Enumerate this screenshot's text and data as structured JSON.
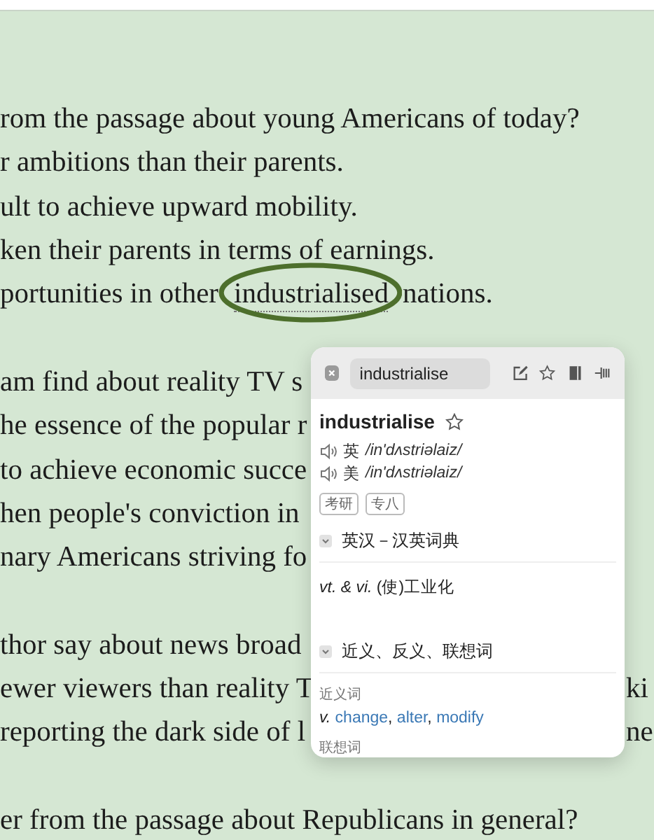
{
  "paragraphs": [
    {
      "lines": [
        {
          "text": "rom the passage about young Americans of today?"
        },
        {
          "text": "r ambitions than their parents."
        },
        {
          "text": "ult to achieve upward mobility."
        },
        {
          "text": "ken their parents in terms of earnings."
        },
        {
          "text": "portunities in other",
          "highlight": "industrialised",
          "after": "nations."
        }
      ]
    },
    {
      "lines": [
        {
          "text": "am find about reality TV s"
        },
        {
          "text": "he essence of the popular r"
        },
        {
          "text": " to achieve economic succe"
        },
        {
          "text": "hen people's conviction in"
        },
        {
          "text": "nary Americans striving fo"
        }
      ]
    },
    {
      "lines": [
        {
          "text": "thor say about news broad"
        },
        {
          "text": "ewer viewers than reality T",
          "right": "ki"
        },
        {
          "text": "reporting the dark side of l",
          "right": "ne"
        }
      ]
    },
    {
      "lines": [
        {
          "text": "er from the passage about Republicans in general?"
        }
      ]
    }
  ],
  "popup": {
    "search": {
      "value": "industrialise"
    },
    "headword": "industrialise",
    "favorite": false,
    "pronunciations": [
      {
        "region": "英",
        "ipa": "/in'dʌstriəlaiz/"
      },
      {
        "region": "美",
        "ipa": "/in'dʌstriəlaiz/"
      }
    ],
    "tags": [
      "考研",
      "专八"
    ],
    "sections": [
      {
        "kind": "definition",
        "title": "英汉－汉英词典",
        "expanded": true,
        "definition": "*vt. & vi.* (使)工业化"
      },
      {
        "kind": "related",
        "title": "近义、反义、联想词",
        "expanded": true,
        "groups": [
          {
            "label": "近义词",
            "pos": "v.",
            "words": [
              "change",
              "alter",
              "modify"
            ],
            "separator": ","
          },
          {
            "label": "联想词"
          }
        ]
      }
    ]
  }
}
